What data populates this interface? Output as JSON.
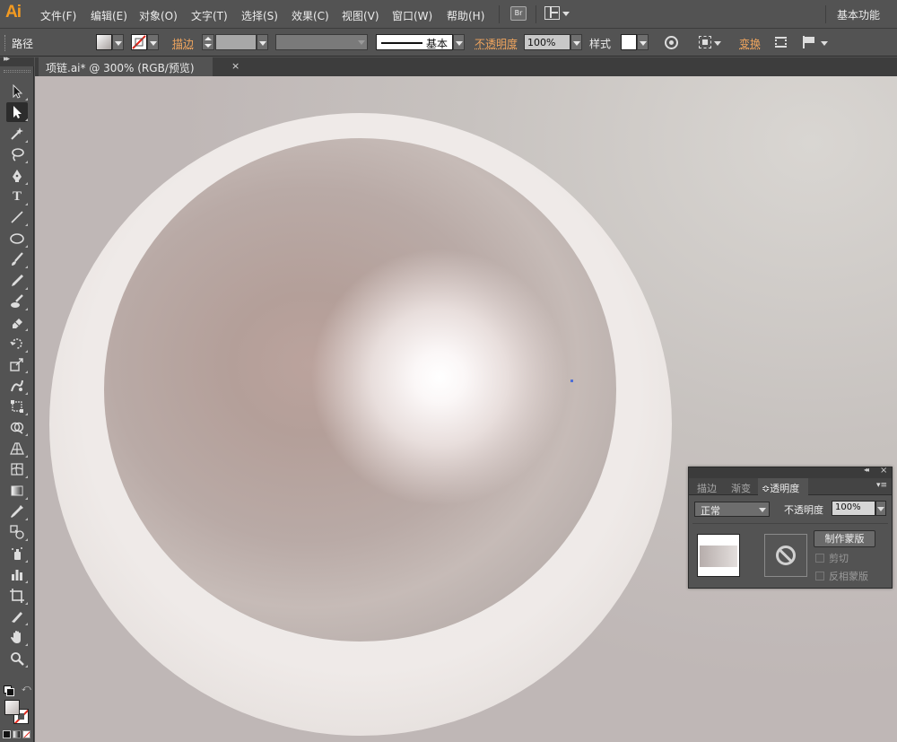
{
  "app": {
    "logo": "Ai",
    "menus": [
      "文件(F)",
      "编辑(E)",
      "对象(O)",
      "文字(T)",
      "选择(S)",
      "效果(C)",
      "视图(V)",
      "窗口(W)",
      "帮助(H)"
    ],
    "bridge_icon_text": "Br",
    "workspace": "基本功能"
  },
  "control_bar": {
    "selection_type": "路径",
    "stroke_label": "描边",
    "brush_label": "基本",
    "opacity_label": "不透明度",
    "opacity_value": "100%",
    "style_label": "样式",
    "transform_label": "变换"
  },
  "document": {
    "tab_title": "项链.ai* @ 300% (RGB/预览)",
    "close_symbol": "×"
  },
  "tools": [
    {
      "name": "selection-tool-icon"
    },
    {
      "name": "direct-selection-tool-icon",
      "selected": true
    },
    {
      "name": "magic-wand-tool-icon"
    },
    {
      "name": "lasso-tool-icon"
    },
    {
      "name": "pen-tool-icon"
    },
    {
      "name": "type-tool-icon",
      "glyph": "T"
    },
    {
      "name": "line-segment-tool-icon"
    },
    {
      "name": "ellipse-tool-icon"
    },
    {
      "name": "paintbrush-tool-icon"
    },
    {
      "name": "pencil-tool-icon"
    },
    {
      "name": "blob-brush-tool-icon"
    },
    {
      "name": "eraser-tool-icon"
    },
    {
      "name": "rotate-tool-icon"
    },
    {
      "name": "scale-tool-icon"
    },
    {
      "name": "warp-tool-icon"
    },
    {
      "name": "free-transform-tool-icon"
    },
    {
      "name": "shape-builder-tool-icon"
    },
    {
      "name": "perspective-grid-tool-icon"
    },
    {
      "name": "mesh-tool-icon"
    },
    {
      "name": "gradient-tool-icon"
    },
    {
      "name": "eyedropper-tool-icon"
    },
    {
      "name": "blend-tool-icon"
    },
    {
      "name": "symbol-sprayer-tool-icon"
    },
    {
      "name": "column-graph-tool-icon"
    },
    {
      "name": "artboard-tool-icon"
    },
    {
      "name": "slice-tool-icon"
    },
    {
      "name": "hand-tool-icon"
    },
    {
      "name": "zoom-tool-icon"
    }
  ],
  "transparency_panel": {
    "tabs": [
      "描边",
      "渐变",
      "透明度"
    ],
    "active_tab_prefix": "≎",
    "blend_mode": "正常",
    "opacity_label": "不透明度",
    "opacity_value": "100%",
    "make_mask_button": "制作蒙版",
    "clip_label": "剪切",
    "invert_mask_label": "反相蒙版"
  },
  "colors": {
    "accent_orange": "#f29a21",
    "ui_gray": "#535353",
    "canvas_bg": "#c9c4c1",
    "selection_point": "#4f6fd6"
  }
}
